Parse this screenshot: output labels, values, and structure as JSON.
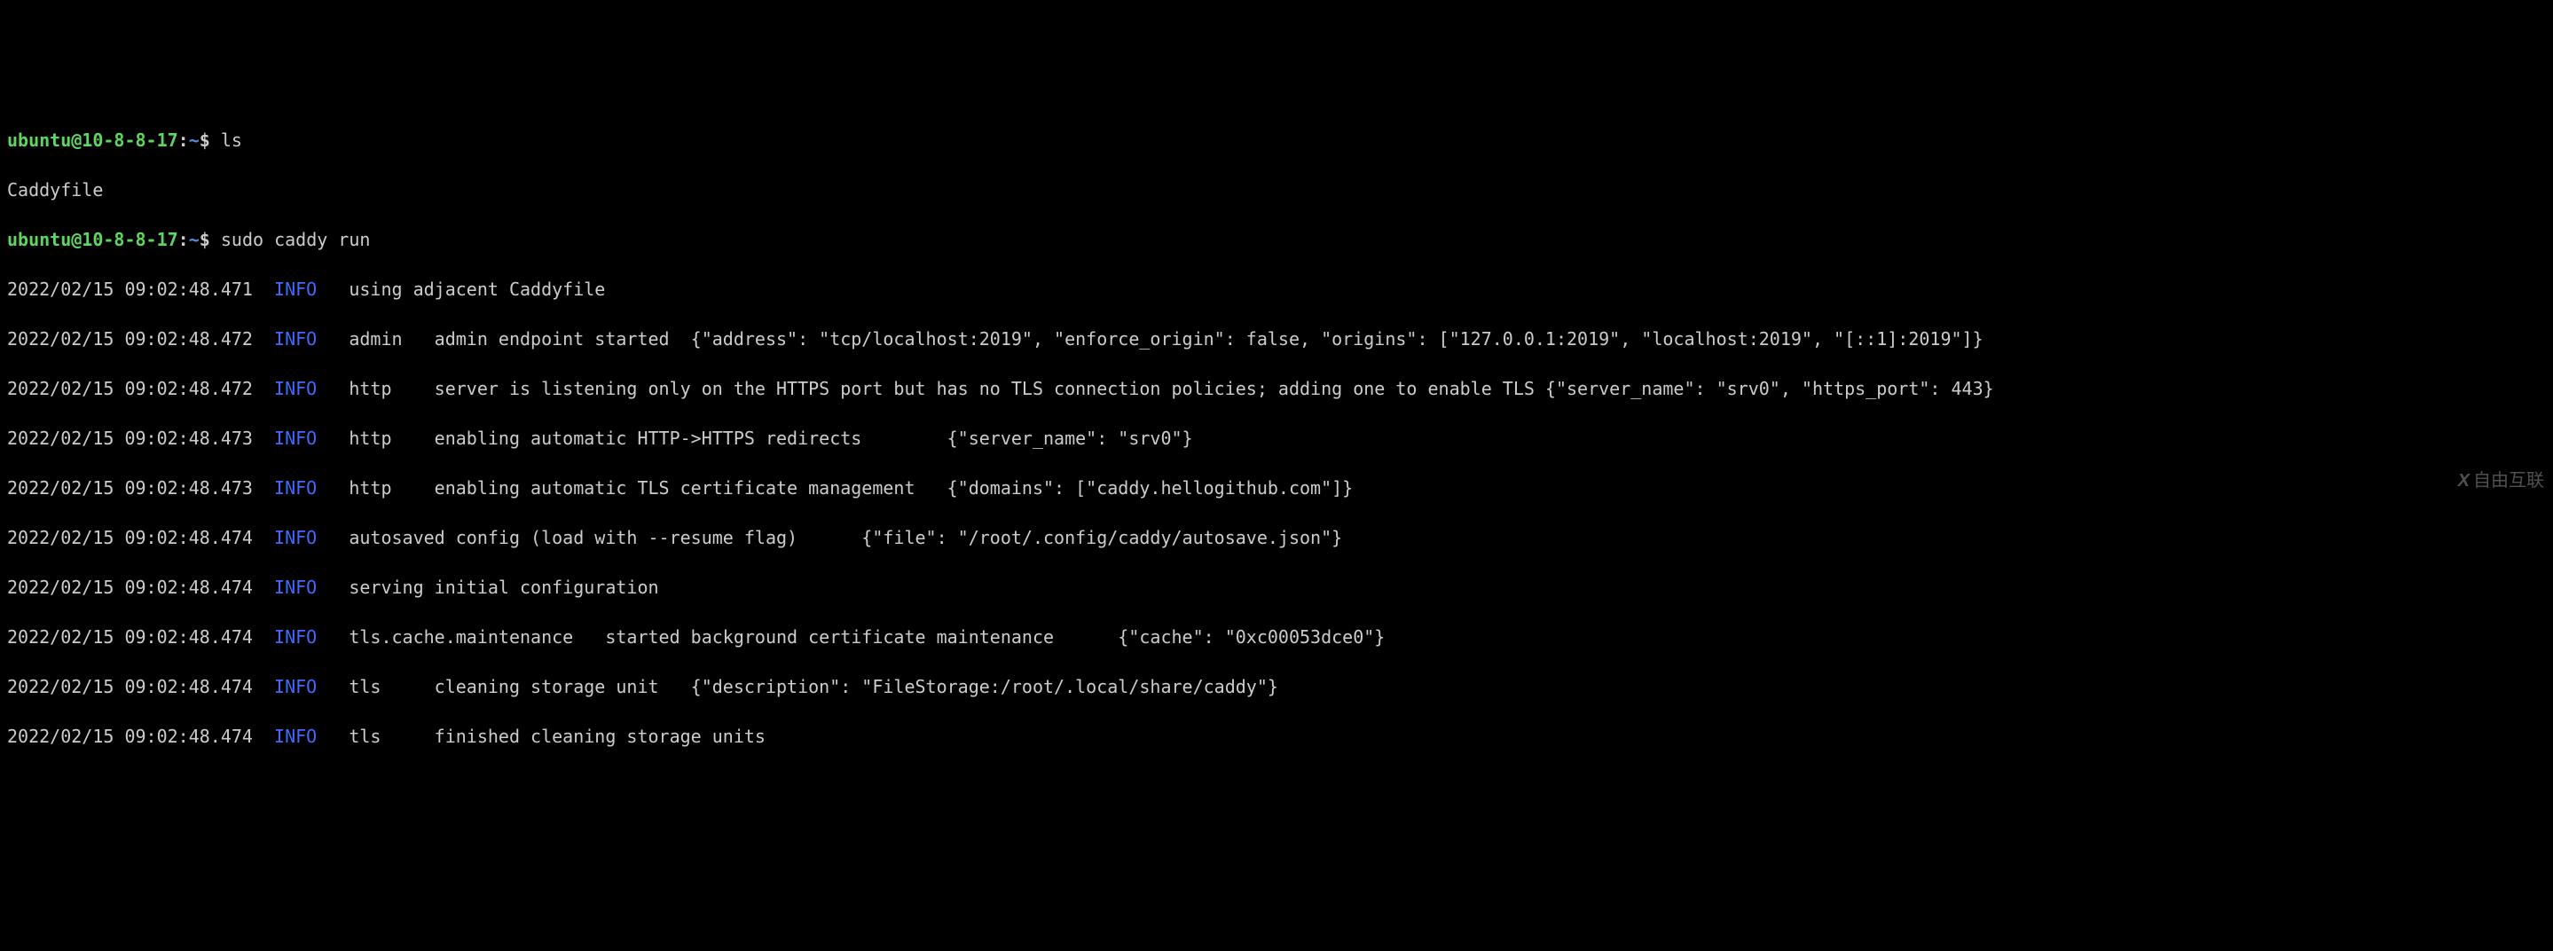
{
  "prompt1": {
    "user": "ubuntu",
    "at": "@",
    "host": "10-8-8-17",
    "colon": ":",
    "path": "~",
    "dollar": "$",
    "command": "ls"
  },
  "ls_output": "Caddyfile",
  "prompt2": {
    "user": "ubuntu",
    "at": "@",
    "host": "10-8-8-17",
    "colon": ":",
    "path": "~",
    "dollar": "$",
    "command": "sudo caddy run"
  },
  "logs": [
    {
      "ts": "2022/02/15 09:02:48.471",
      "level": "INFO",
      "msg": "   using adjacent Caddyfile"
    },
    {
      "ts": "2022/02/15 09:02:48.472",
      "level": "INFO",
      "msg": "   admin   admin endpoint started  {\"address\": \"tcp/localhost:2019\", \"enforce_origin\": false, \"origins\": [\"127.0.0.1:2019\", \"localhost:2019\", \"[::1]:2019\"]}"
    },
    {
      "ts": "2022/02/15 09:02:48.472",
      "level": "INFO",
      "msg": "   http    server is listening only on the HTTPS port but has no TLS connection policies; adding one to enable TLS {\"server_name\": \"srv0\", \"https_port\": 443}"
    },
    {
      "ts": "2022/02/15 09:02:48.473",
      "level": "INFO",
      "msg": "   http    enabling automatic HTTP->HTTPS redirects        {\"server_name\": \"srv0\"}"
    },
    {
      "ts": "2022/02/15 09:02:48.473",
      "level": "INFO",
      "msg": "   http    enabling automatic TLS certificate management   {\"domains\": [\"caddy.hellogithub.com\"]}"
    },
    {
      "ts": "2022/02/15 09:02:48.474",
      "level": "INFO",
      "msg": "   autosaved config (load with --resume flag)      {\"file\": \"/root/.config/caddy/autosave.json\"}"
    },
    {
      "ts": "2022/02/15 09:02:48.474",
      "level": "INFO",
      "msg": "   serving initial configuration"
    },
    {
      "ts": "2022/02/15 09:02:48.474",
      "level": "INFO",
      "msg": "   tls.cache.maintenance   started background certificate maintenance      {\"cache\": \"0xc00053dce0\"}"
    },
    {
      "ts": "2022/02/15 09:02:48.474",
      "level": "INFO",
      "msg": "   tls     cleaning storage unit   {\"description\": \"FileStorage:/root/.local/share/caddy\"}"
    },
    {
      "ts": "2022/02/15 09:02:48.474",
      "level": "INFO",
      "msg": "   tls     finished cleaning storage units"
    }
  ],
  "watermark": {
    "icon": "X",
    "text": "自由互联"
  }
}
